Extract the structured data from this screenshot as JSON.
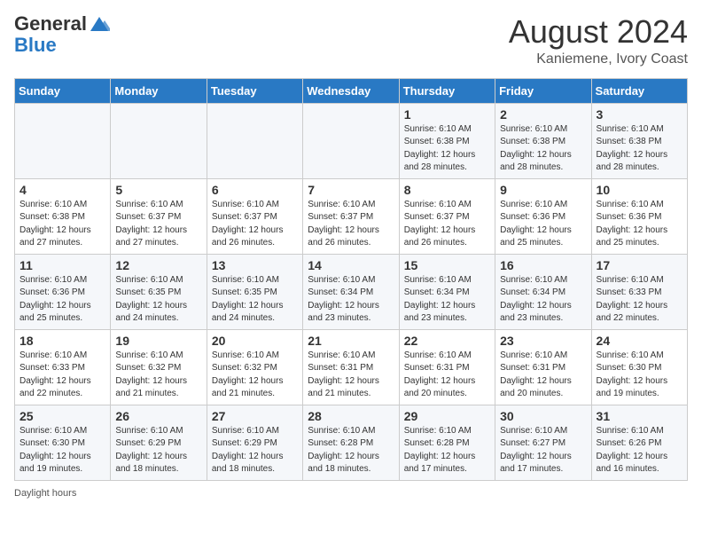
{
  "header": {
    "logo_general": "General",
    "logo_blue": "Blue",
    "month_title": "August 2024",
    "location": "Kaniemene, Ivory Coast"
  },
  "days_of_week": [
    "Sunday",
    "Monday",
    "Tuesday",
    "Wednesday",
    "Thursday",
    "Friday",
    "Saturday"
  ],
  "footer": {
    "daylight_label": "Daylight hours"
  },
  "weeks": [
    [
      {
        "day": "",
        "info": ""
      },
      {
        "day": "",
        "info": ""
      },
      {
        "day": "",
        "info": ""
      },
      {
        "day": "",
        "info": ""
      },
      {
        "day": "1",
        "info": "Sunrise: 6:10 AM\nSunset: 6:38 PM\nDaylight: 12 hours\nand 28 minutes."
      },
      {
        "day": "2",
        "info": "Sunrise: 6:10 AM\nSunset: 6:38 PM\nDaylight: 12 hours\nand 28 minutes."
      },
      {
        "day": "3",
        "info": "Sunrise: 6:10 AM\nSunset: 6:38 PM\nDaylight: 12 hours\nand 28 minutes."
      }
    ],
    [
      {
        "day": "4",
        "info": "Sunrise: 6:10 AM\nSunset: 6:38 PM\nDaylight: 12 hours\nand 27 minutes."
      },
      {
        "day": "5",
        "info": "Sunrise: 6:10 AM\nSunset: 6:37 PM\nDaylight: 12 hours\nand 27 minutes."
      },
      {
        "day": "6",
        "info": "Sunrise: 6:10 AM\nSunset: 6:37 PM\nDaylight: 12 hours\nand 26 minutes."
      },
      {
        "day": "7",
        "info": "Sunrise: 6:10 AM\nSunset: 6:37 PM\nDaylight: 12 hours\nand 26 minutes."
      },
      {
        "day": "8",
        "info": "Sunrise: 6:10 AM\nSunset: 6:37 PM\nDaylight: 12 hours\nand 26 minutes."
      },
      {
        "day": "9",
        "info": "Sunrise: 6:10 AM\nSunset: 6:36 PM\nDaylight: 12 hours\nand 25 minutes."
      },
      {
        "day": "10",
        "info": "Sunrise: 6:10 AM\nSunset: 6:36 PM\nDaylight: 12 hours\nand 25 minutes."
      }
    ],
    [
      {
        "day": "11",
        "info": "Sunrise: 6:10 AM\nSunset: 6:36 PM\nDaylight: 12 hours\nand 25 minutes."
      },
      {
        "day": "12",
        "info": "Sunrise: 6:10 AM\nSunset: 6:35 PM\nDaylight: 12 hours\nand 24 minutes."
      },
      {
        "day": "13",
        "info": "Sunrise: 6:10 AM\nSunset: 6:35 PM\nDaylight: 12 hours\nand 24 minutes."
      },
      {
        "day": "14",
        "info": "Sunrise: 6:10 AM\nSunset: 6:34 PM\nDaylight: 12 hours\nand 23 minutes."
      },
      {
        "day": "15",
        "info": "Sunrise: 6:10 AM\nSunset: 6:34 PM\nDaylight: 12 hours\nand 23 minutes."
      },
      {
        "day": "16",
        "info": "Sunrise: 6:10 AM\nSunset: 6:34 PM\nDaylight: 12 hours\nand 23 minutes."
      },
      {
        "day": "17",
        "info": "Sunrise: 6:10 AM\nSunset: 6:33 PM\nDaylight: 12 hours\nand 22 minutes."
      }
    ],
    [
      {
        "day": "18",
        "info": "Sunrise: 6:10 AM\nSunset: 6:33 PM\nDaylight: 12 hours\nand 22 minutes."
      },
      {
        "day": "19",
        "info": "Sunrise: 6:10 AM\nSunset: 6:32 PM\nDaylight: 12 hours\nand 21 minutes."
      },
      {
        "day": "20",
        "info": "Sunrise: 6:10 AM\nSunset: 6:32 PM\nDaylight: 12 hours\nand 21 minutes."
      },
      {
        "day": "21",
        "info": "Sunrise: 6:10 AM\nSunset: 6:31 PM\nDaylight: 12 hours\nand 21 minutes."
      },
      {
        "day": "22",
        "info": "Sunrise: 6:10 AM\nSunset: 6:31 PM\nDaylight: 12 hours\nand 20 minutes."
      },
      {
        "day": "23",
        "info": "Sunrise: 6:10 AM\nSunset: 6:31 PM\nDaylight: 12 hours\nand 20 minutes."
      },
      {
        "day": "24",
        "info": "Sunrise: 6:10 AM\nSunset: 6:30 PM\nDaylight: 12 hours\nand 19 minutes."
      }
    ],
    [
      {
        "day": "25",
        "info": "Sunrise: 6:10 AM\nSunset: 6:30 PM\nDaylight: 12 hours\nand 19 minutes."
      },
      {
        "day": "26",
        "info": "Sunrise: 6:10 AM\nSunset: 6:29 PM\nDaylight: 12 hours\nand 18 minutes."
      },
      {
        "day": "27",
        "info": "Sunrise: 6:10 AM\nSunset: 6:29 PM\nDaylight: 12 hours\nand 18 minutes."
      },
      {
        "day": "28",
        "info": "Sunrise: 6:10 AM\nSunset: 6:28 PM\nDaylight: 12 hours\nand 18 minutes."
      },
      {
        "day": "29",
        "info": "Sunrise: 6:10 AM\nSunset: 6:28 PM\nDaylight: 12 hours\nand 17 minutes."
      },
      {
        "day": "30",
        "info": "Sunrise: 6:10 AM\nSunset: 6:27 PM\nDaylight: 12 hours\nand 17 minutes."
      },
      {
        "day": "31",
        "info": "Sunrise: 6:10 AM\nSunset: 6:26 PM\nDaylight: 12 hours\nand 16 minutes."
      }
    ]
  ]
}
